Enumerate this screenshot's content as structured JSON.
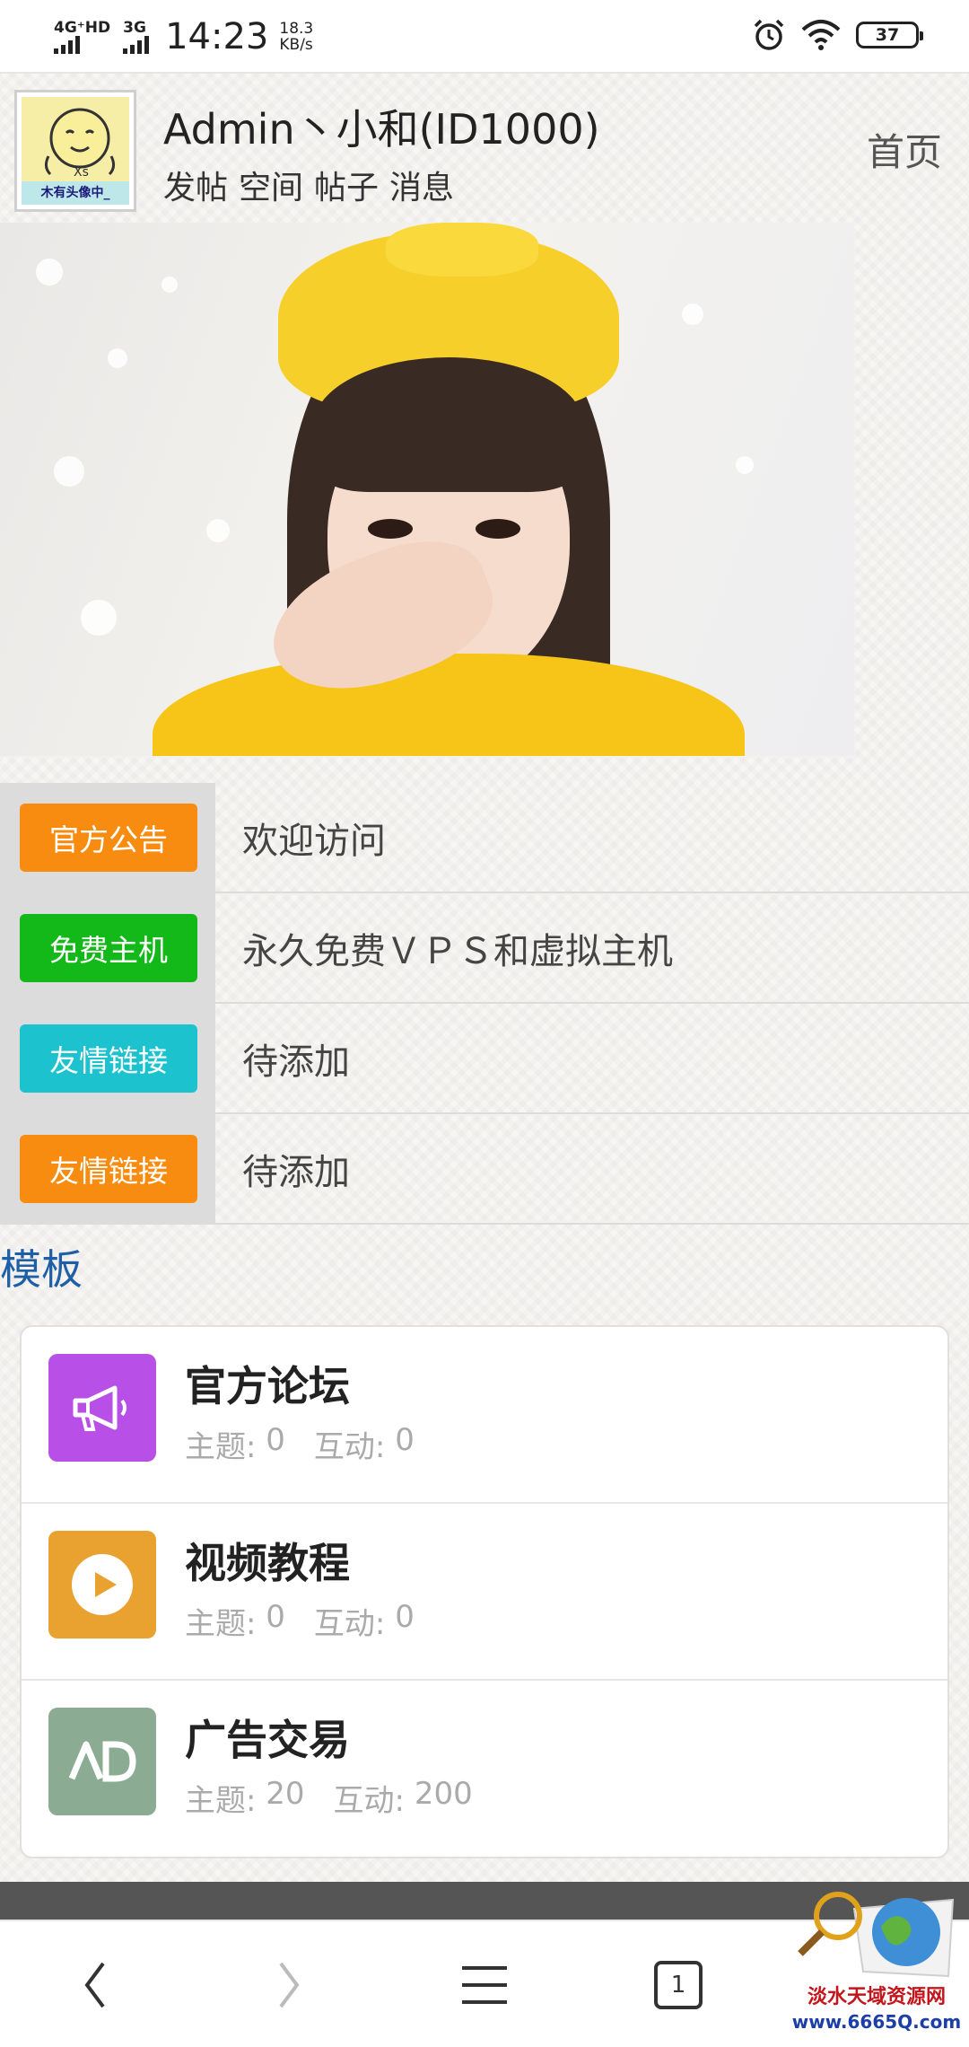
{
  "status_bar": {
    "network1": "4G⁺HD",
    "network2": "3G",
    "time": "14:23",
    "speed_value": "18.3",
    "speed_unit": "KB/s",
    "battery": "37"
  },
  "header": {
    "avatar_caption": "木有头像中_",
    "username": "Admin丶小和(ID1000)",
    "nav": [
      "发帖",
      "空间",
      "帖子",
      "消息"
    ],
    "home_link": "首页"
  },
  "notices": [
    {
      "tag": "官方公告",
      "tag_color": "#f78c11",
      "text": "欢迎访问"
    },
    {
      "tag": "免费主机",
      "tag_color": "#13b919",
      "text": "永久免费ＶＰＳ和虚拟主机"
    },
    {
      "tag": "友情链接",
      "tag_color": "#1cc3cf",
      "text": "待添加"
    },
    {
      "tag": "友情链接",
      "tag_color": "#f78c11",
      "text": "待添加"
    }
  ],
  "section_title": "模板",
  "forums": [
    {
      "name": "官方论坛",
      "icon": "megaphone-icon",
      "icon_color": "#b84fe6",
      "topics_label": "主题:",
      "topics": "0",
      "replies_label": "互动:",
      "replies": "0"
    },
    {
      "name": "视频教程",
      "icon": "play-icon",
      "icon_color": "#e9a130",
      "topics_label": "主题:",
      "topics": "0",
      "replies_label": "互动:",
      "replies": "0"
    },
    {
      "name": "广告交易",
      "icon": "ad-icon",
      "icon_color": "#8bab92",
      "topics_label": "主题:",
      "topics": "20",
      "replies_label": "互动:",
      "replies": "200"
    }
  ],
  "bottom_bar": {
    "tab_count": "1"
  },
  "watermark": {
    "text": "淡水天域资源网",
    "url": "www.6665Q.com"
  }
}
